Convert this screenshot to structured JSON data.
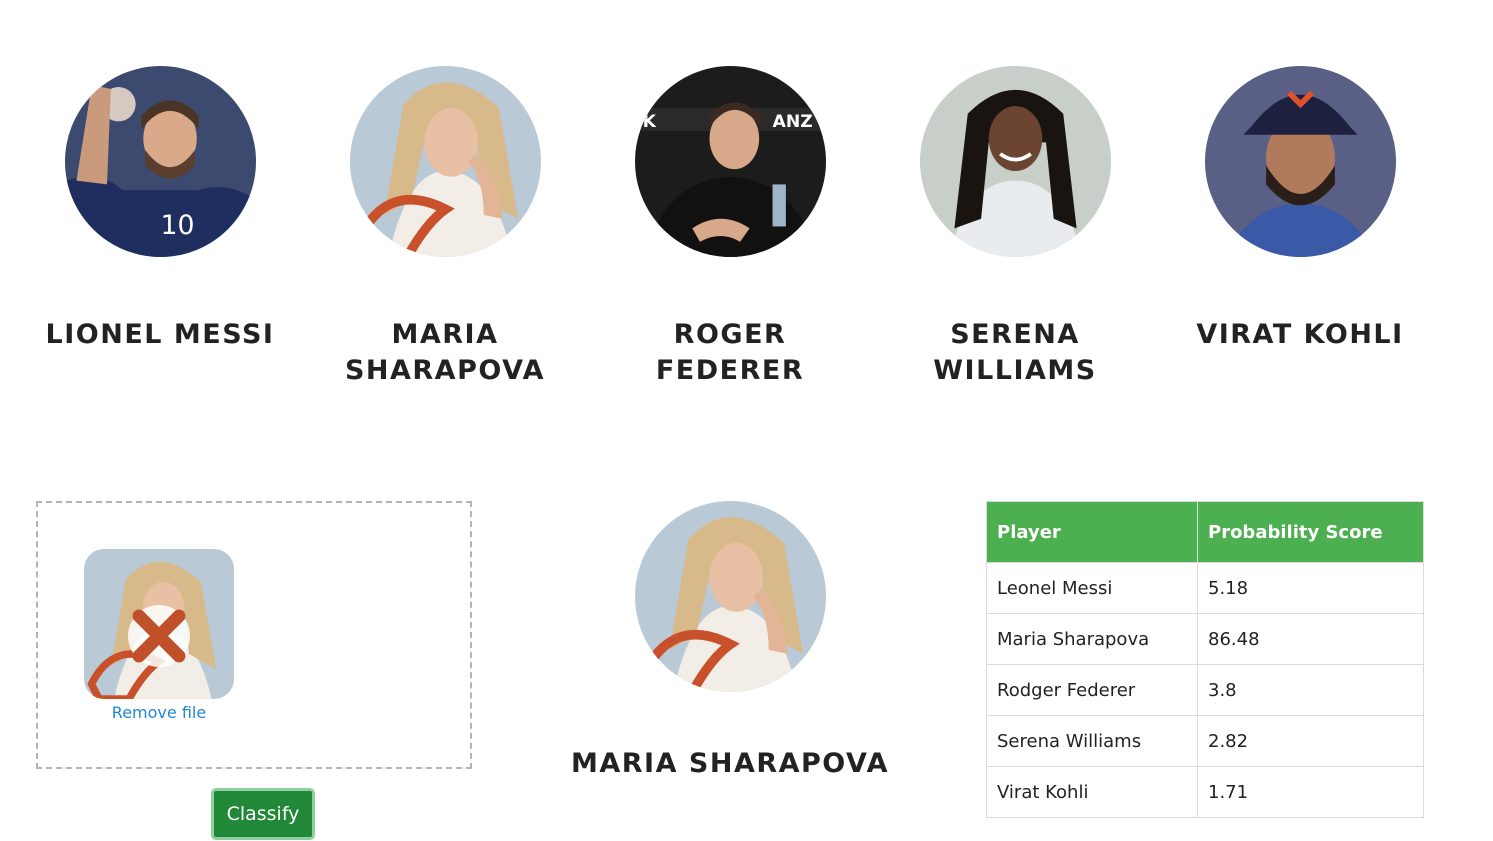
{
  "players": [
    {
      "name": "LIONEL MESSI",
      "photo": "messi-photo",
      "colors": {
        "bg": "#3b4a6e",
        "shirt": "#1f2e5e",
        "skin": "#d9a98a",
        "hair": "#4a3426"
      }
    },
    {
      "name": "MARIA SHARAPOVA",
      "photo": "sharapova-photo",
      "colors": {
        "bg": "#b9c9d6",
        "shirt": "#f2ede6",
        "skin": "#e8c0a4",
        "hair": "#d8b98a"
      }
    },
    {
      "name": "ROGER FEDERER",
      "photo": "federer-photo",
      "colors": {
        "bg": "#1c1c1c",
        "shirt": "#111111",
        "skin": "#d8a88a",
        "hair": "#3a2a22"
      }
    },
    {
      "name": "SERENA WILLIAMS",
      "photo": "williams-photo",
      "colors": {
        "bg": "#c7cfc8",
        "shirt": "#e9ecef",
        "skin": "#6b4432",
        "hair": "#1a1410"
      }
    },
    {
      "name": "VIRAT KOHLI",
      "photo": "kohli-photo",
      "colors": {
        "bg": "#5a5f86",
        "shirt": "#3a5aa8",
        "skin": "#b07a5c",
        "hair": "#1e2040"
      }
    }
  ],
  "upload": {
    "remove_label": "Remove file",
    "classify_label": "Classify"
  },
  "result": {
    "name": "MARIA SHARAPOVA"
  },
  "table": {
    "headers": [
      "Player",
      "Probability Score"
    ],
    "rows": [
      [
        "Leonel Messi",
        "5.18"
      ],
      [
        "Maria Sharapova",
        "86.48"
      ],
      [
        "Rodger Federer",
        "3.8"
      ],
      [
        "Serena Williams",
        "2.82"
      ],
      [
        "Virat Kohli",
        "1.71"
      ]
    ]
  },
  "colors": {
    "header_green": "#4caf50",
    "button_green": "#218838",
    "link_blue": "#1e88d6"
  }
}
